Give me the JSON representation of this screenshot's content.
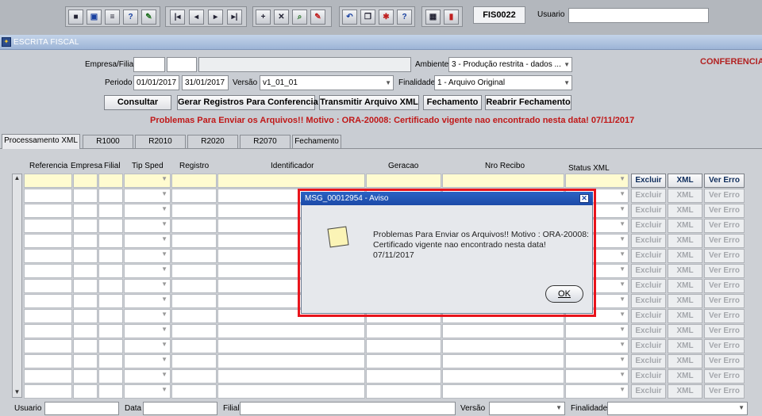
{
  "toolbar": {
    "buttons": [
      "save-icon",
      "window-icon",
      "print-icon",
      "help-icon",
      "edit-icon",
      "first-icon",
      "prev-icon",
      "next-icon",
      "last-icon",
      "insert-icon",
      "delete-icon",
      "query-icon",
      "clear-icon",
      "undo-icon",
      "copy-icon",
      "tools-icon",
      "question-icon",
      "calendar-icon",
      "exit-icon"
    ],
    "form_code": "FIS0022",
    "usuario_label": "Usuario",
    "usuario_value": ""
  },
  "window": {
    "title": "ESCRITA FISCAL",
    "status_label": "CONFERENCIA"
  },
  "form": {
    "empresa_label": "Empresa/Filial",
    "empresa_value": "",
    "filial_value": "",
    "empresa_name": "",
    "ambiente_label": "Ambiente",
    "ambiente_value": "3 - Produção restrita - dados ...",
    "periodo_label": "Periodo",
    "periodo_start": "01/01/2017",
    "periodo_end": "31/01/2017",
    "versao_label": "Versão",
    "versao_value": "v1_01_01",
    "finalidade_label": "Finalidade",
    "finalidade_value": "1 - Arquivo Original",
    "buttons": {
      "consultar": "Consultar",
      "gerar": "Gerar Registros Para Conferencia",
      "transmitir": "Transmitir Arquivo XML",
      "fechamento": "Fechamento",
      "reabrir": "Reabrir Fechamento"
    },
    "error_message": "Problemas Para Enviar os Arquivos!! Motivo : ORA-20008: Certificado vigente nao encontrado nesta data! 07/11/2017"
  },
  "tabs": [
    {
      "label": "Processamento XML",
      "active": true
    },
    {
      "label": "R1000",
      "active": false
    },
    {
      "label": "R2010",
      "active": false
    },
    {
      "label": "R2020",
      "active": false
    },
    {
      "label": "R2070",
      "active": false
    },
    {
      "label": "Fechamento",
      "active": false
    }
  ],
  "grid": {
    "columns": [
      "Referencia",
      "Empresa",
      "Filial",
      "Tip Sped",
      "Registro",
      "Identificador",
      "Geracao",
      "Nro Recibo",
      "Status XML"
    ],
    "row_count": 15,
    "row_buttons": {
      "excluir": "Excluir",
      "xml": "XML",
      "ver_erro": "Ver Erro"
    }
  },
  "dialog": {
    "title": "MSG_00012954 - Aviso",
    "message": "Problemas Para Enviar os Arquivos!! Motivo : ORA-20008: Certificado vigente nao encontrado nesta data! 07/11/2017",
    "ok_label": "OK"
  },
  "statusbar": {
    "usuario_label": "Usuario",
    "data_label": "Data",
    "filial_label": "Filial",
    "versao_label": "Versão",
    "finalidade_label": "Finalidade"
  },
  "colors": {
    "accent_red": "#c01818",
    "dialog_title": "#1c4aa8",
    "highlight_outline": "#e8141c"
  }
}
